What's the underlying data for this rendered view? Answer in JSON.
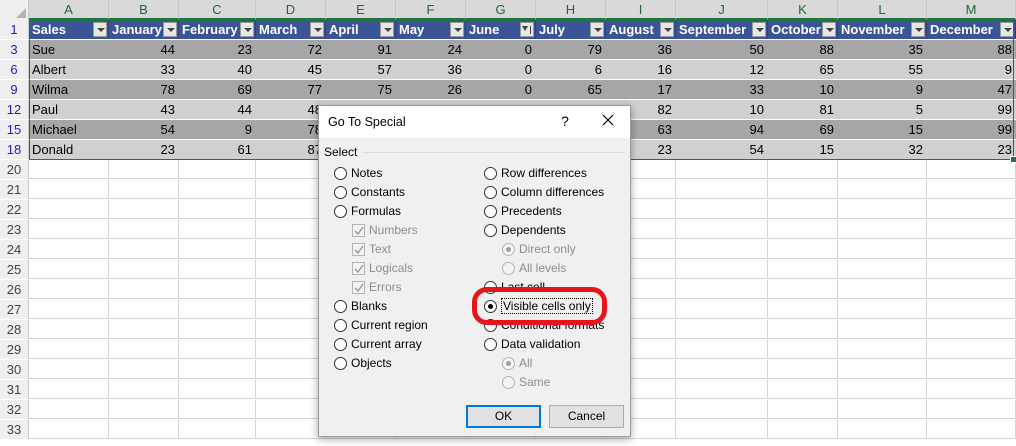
{
  "spreadsheet": {
    "columns": [
      "A",
      "B",
      "C",
      "D",
      "E",
      "F",
      "G",
      "H",
      "I",
      "J",
      "K",
      "L",
      "M"
    ],
    "header_row": {
      "row_number": "1",
      "labels": [
        "Sales",
        "January",
        "February",
        "March",
        "April",
        "May",
        "June",
        "July",
        "August",
        "September",
        "October",
        "November",
        "December"
      ]
    },
    "data_rows": [
      {
        "row_number": "3",
        "name": "Sue",
        "values": [
          "44",
          "23",
          "72",
          "91",
          "24",
          "0",
          "79",
          "36",
          "50",
          "88",
          "35",
          "88"
        ]
      },
      {
        "row_number": "6",
        "name": "Albert",
        "values": [
          "33",
          "40",
          "45",
          "57",
          "36",
          "0",
          "6",
          "16",
          "12",
          "65",
          "55",
          "9"
        ]
      },
      {
        "row_number": "9",
        "name": "Wilma",
        "values": [
          "78",
          "69",
          "77",
          "75",
          "26",
          "0",
          "65",
          "17",
          "33",
          "10",
          "9",
          "47"
        ]
      },
      {
        "row_number": "12",
        "name": "Paul",
        "values": [
          "43",
          "44",
          "48",
          "",
          "",
          "",
          "",
          "82",
          "10",
          "81",
          "5",
          "99"
        ]
      },
      {
        "row_number": "15",
        "name": "Michael",
        "values": [
          "54",
          "9",
          "78",
          "",
          "",
          "",
          "",
          "63",
          "94",
          "69",
          "15",
          "99"
        ]
      },
      {
        "row_number": "18",
        "name": "Donald",
        "values": [
          "23",
          "61",
          "87",
          "",
          "",
          "",
          "",
          "23",
          "54",
          "15",
          "32",
          "23"
        ]
      }
    ],
    "empty_rows": [
      "20",
      "21",
      "22",
      "23",
      "24",
      "25",
      "26",
      "27",
      "28",
      "29",
      "30",
      "31",
      "32",
      "33"
    ]
  },
  "dialog": {
    "title": "Go To Special",
    "help_glyph": "?",
    "group_label": "Select",
    "left_options": [
      {
        "label": "Notes",
        "type": "radio",
        "checked": false,
        "disabled": false
      },
      {
        "label": "Constants",
        "type": "radio",
        "checked": false,
        "disabled": false
      },
      {
        "label": "Formulas",
        "type": "radio",
        "checked": false,
        "disabled": false
      },
      {
        "label": "Numbers",
        "type": "check",
        "checked": true,
        "disabled": true
      },
      {
        "label": "Text",
        "type": "check",
        "checked": true,
        "disabled": true
      },
      {
        "label": "Logicals",
        "type": "check",
        "checked": true,
        "disabled": true
      },
      {
        "label": "Errors",
        "type": "check",
        "checked": true,
        "disabled": true
      },
      {
        "label": "Blanks",
        "type": "radio",
        "checked": false,
        "disabled": false
      },
      {
        "label": "Current region",
        "type": "radio",
        "checked": false,
        "disabled": false
      },
      {
        "label": "Current array",
        "type": "radio",
        "checked": false,
        "disabled": false
      },
      {
        "label": "Objects",
        "type": "radio",
        "checked": false,
        "disabled": false
      }
    ],
    "right_options": [
      {
        "label": "Row differences",
        "type": "radio",
        "checked": false,
        "disabled": false
      },
      {
        "label": "Column differences",
        "type": "radio",
        "checked": false,
        "disabled": false
      },
      {
        "label": "Precedents",
        "type": "radio",
        "checked": false,
        "disabled": false
      },
      {
        "label": "Dependents",
        "type": "radio",
        "checked": false,
        "disabled": false
      },
      {
        "label": "Direct only",
        "type": "radio",
        "checked": true,
        "disabled": true
      },
      {
        "label": "All levels",
        "type": "radio",
        "checked": false,
        "disabled": true
      },
      {
        "label": "Last cell",
        "type": "radio",
        "checked": false,
        "disabled": false
      },
      {
        "label": "Visible cells only",
        "type": "radio",
        "checked": true,
        "disabled": false
      },
      {
        "label": "Conditional formats",
        "type": "radio",
        "checked": false,
        "disabled": false
      },
      {
        "label": "Data validation",
        "type": "radio",
        "checked": false,
        "disabled": false
      },
      {
        "label": "All",
        "type": "radio",
        "checked": true,
        "disabled": true
      },
      {
        "label": "Same",
        "type": "radio",
        "checked": false,
        "disabled": true
      }
    ],
    "ok_label": "OK",
    "cancel_label": "Cancel"
  },
  "colors": {
    "table_header": "#3a5496",
    "band_dark": "#a6a6a6",
    "band_light": "#d0d0d0",
    "selection": "#217346",
    "callout": "#e8141c"
  },
  "icons": {
    "close": "close-icon",
    "filter_dropdown": "dropdown-arrow-icon",
    "filter_applied": "filter-icon"
  }
}
